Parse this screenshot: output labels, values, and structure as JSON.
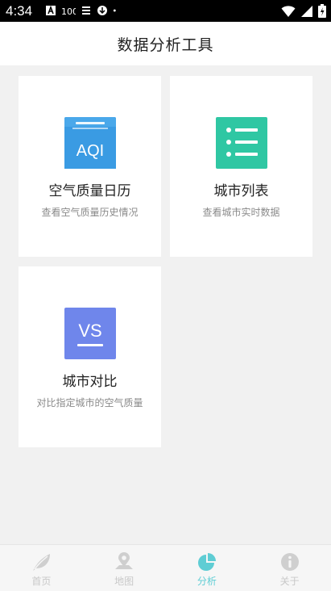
{
  "status_bar": {
    "time": "4:34",
    "icons_left": [
      "a-notification-icon",
      "100-notification-icon",
      "usb-debug-icon",
      "download-icon",
      "dot-icon"
    ],
    "icons_right": [
      "wifi-icon",
      "cell-signal-icon",
      "battery-icon"
    ]
  },
  "header": {
    "title": "数据分析工具"
  },
  "cards": [
    {
      "title": "空气质量日历",
      "desc": "查看空气质量历史情况",
      "icon": "aqi-icon",
      "icon_text": "AQI",
      "color": "#3fa2e6"
    },
    {
      "title": "城市列表",
      "desc": "查看城市实时数据",
      "icon": "list-icon",
      "color": "#2fc7a3"
    },
    {
      "title": "城市对比",
      "desc": "对比指定城市的空气质量",
      "icon": "vs-icon",
      "icon_text": "VS",
      "color": "#6f86eb"
    }
  ],
  "nav": {
    "items": [
      {
        "label": "首页",
        "icon": "leaf-icon"
      },
      {
        "label": "地图",
        "icon": "map-pin-icon"
      },
      {
        "label": "分析",
        "icon": "pie-chart-icon",
        "active": true
      },
      {
        "label": "关于",
        "icon": "info-icon"
      }
    ],
    "active_color": "#5fcdd4",
    "inactive_color": "#cfcfcf"
  }
}
